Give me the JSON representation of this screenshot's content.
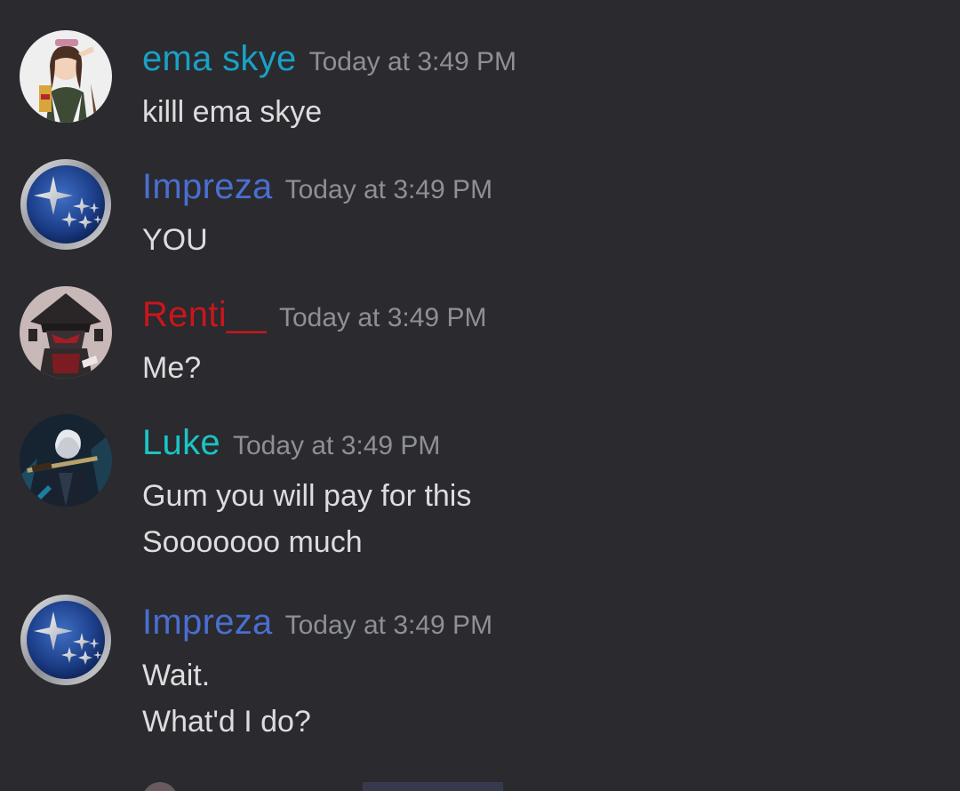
{
  "messages": [
    {
      "username": "ema skye",
      "color": "#1aa1c4",
      "timestamp": "Today at 3:49 PM",
      "avatar": "anime-girl-avatar",
      "lines": [
        "killl ema skye"
      ]
    },
    {
      "username": "Impreza",
      "color": "#4a6fd0",
      "timestamp": "Today at 3:49 PM",
      "avatar": "subaru-stars-avatar",
      "lines": [
        "YOU"
      ]
    },
    {
      "username": "Renti__",
      "color": "#c8171b",
      "timestamp": "Today at 3:49 PM",
      "avatar": "hooded-figure-avatar",
      "lines": [
        "Me?"
      ]
    },
    {
      "username": "Luke",
      "color": "#1bc4c4",
      "timestamp": "Today at 3:49 PM",
      "avatar": "swordsman-avatar",
      "lines": [
        "Gum you will pay for this",
        "Sooooooo much"
      ]
    },
    {
      "username": "Impreza",
      "color": "#4a6fd0",
      "timestamp": "Today at 3:49 PM",
      "avatar": "subaru-stars-avatar",
      "lines": [
        "Wait.",
        "What'd I do?"
      ]
    }
  ]
}
